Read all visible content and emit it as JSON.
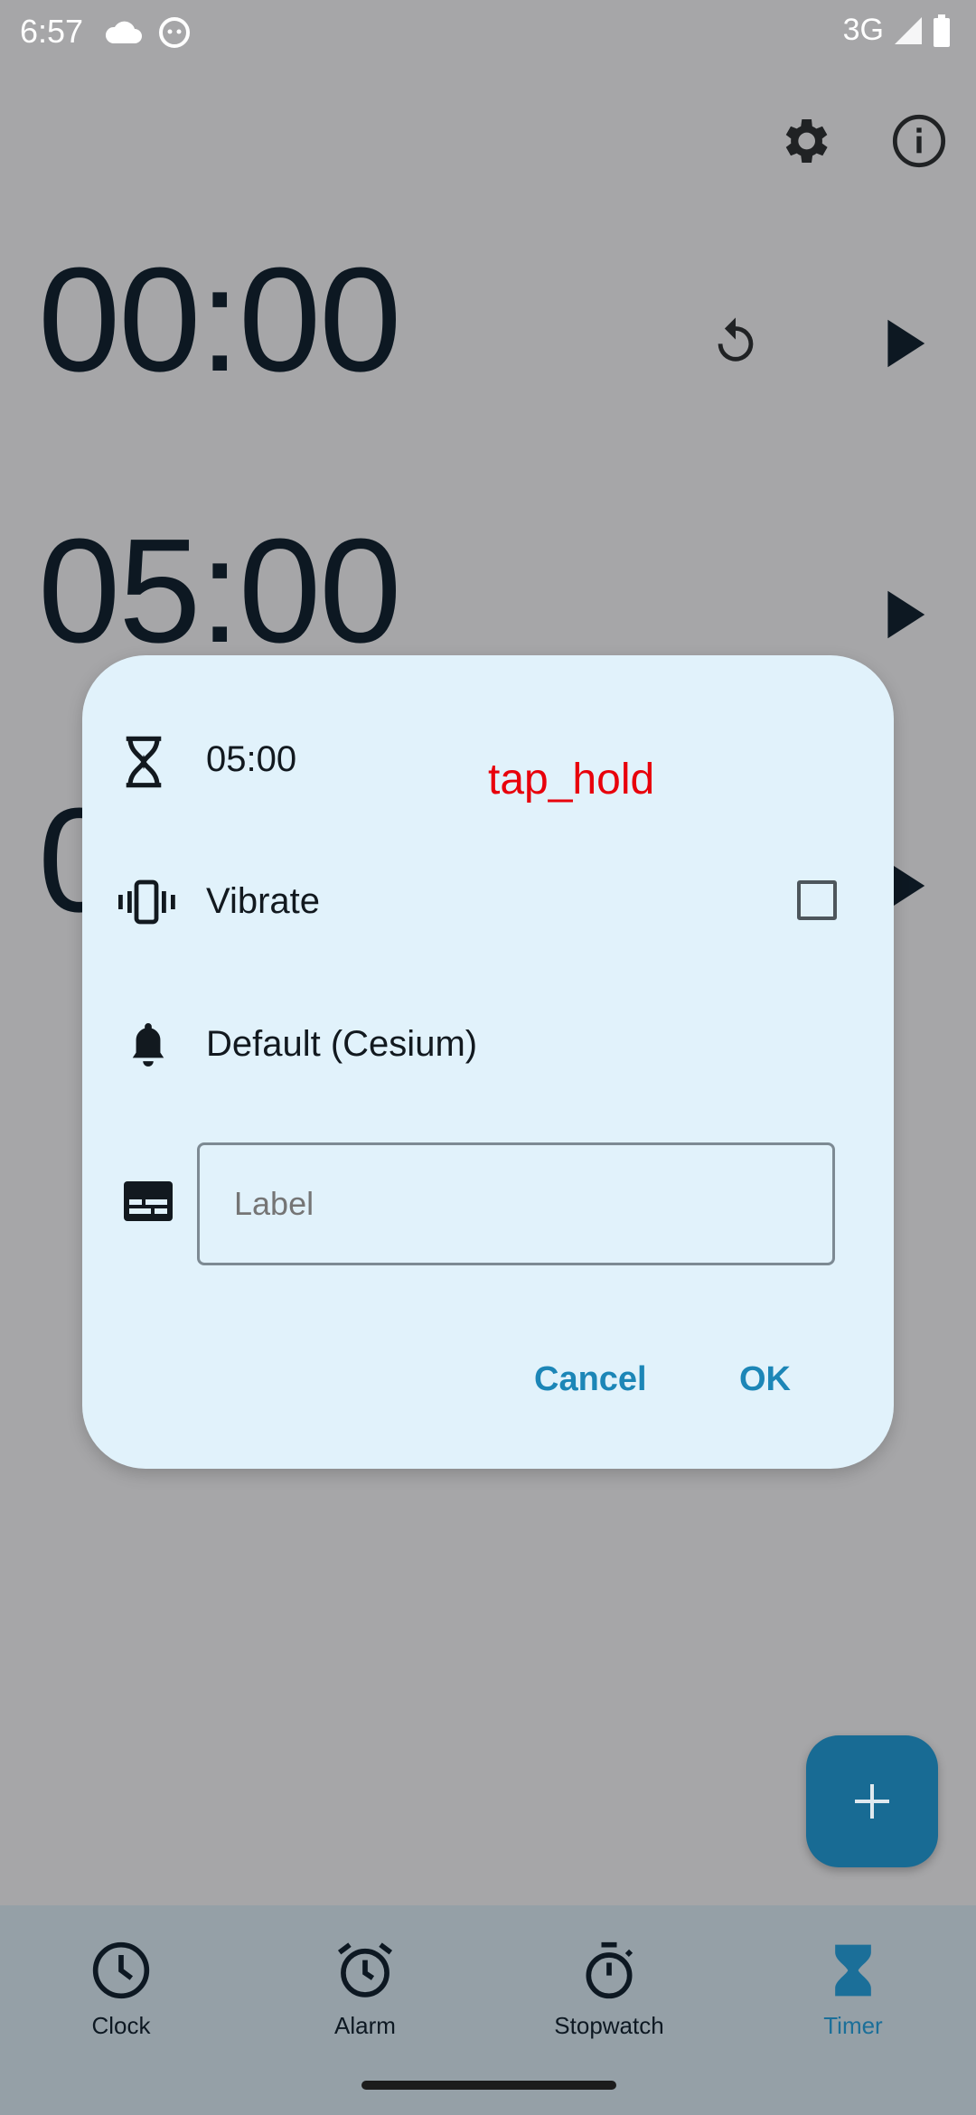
{
  "status_bar": {
    "time": "6:57",
    "network": "3G"
  },
  "timers": [
    {
      "time": "00:00"
    },
    {
      "time": "05:00"
    },
    {
      "time": "0"
    }
  ],
  "dialog": {
    "duration": "05:00",
    "vibrate_label": "Vibrate",
    "vibrate_checked": false,
    "sound_label": "Default (Cesium)",
    "label_placeholder": "Label",
    "cancel_label": "Cancel",
    "ok_label": "OK"
  },
  "annotation": "tap_hold",
  "bottom_nav": {
    "items": [
      {
        "label": "Clock",
        "icon": "clock-icon"
      },
      {
        "label": "Alarm",
        "icon": "alarm-icon"
      },
      {
        "label": "Stopwatch",
        "icon": "stopwatch-icon"
      },
      {
        "label": "Timer",
        "icon": "timer-icon",
        "active": true
      }
    ]
  },
  "colors": {
    "accent": "#1c86b7",
    "fab": "#186b94",
    "dialog_bg": "#e1f2fb",
    "scrim_bg": "#a6a6a8"
  }
}
